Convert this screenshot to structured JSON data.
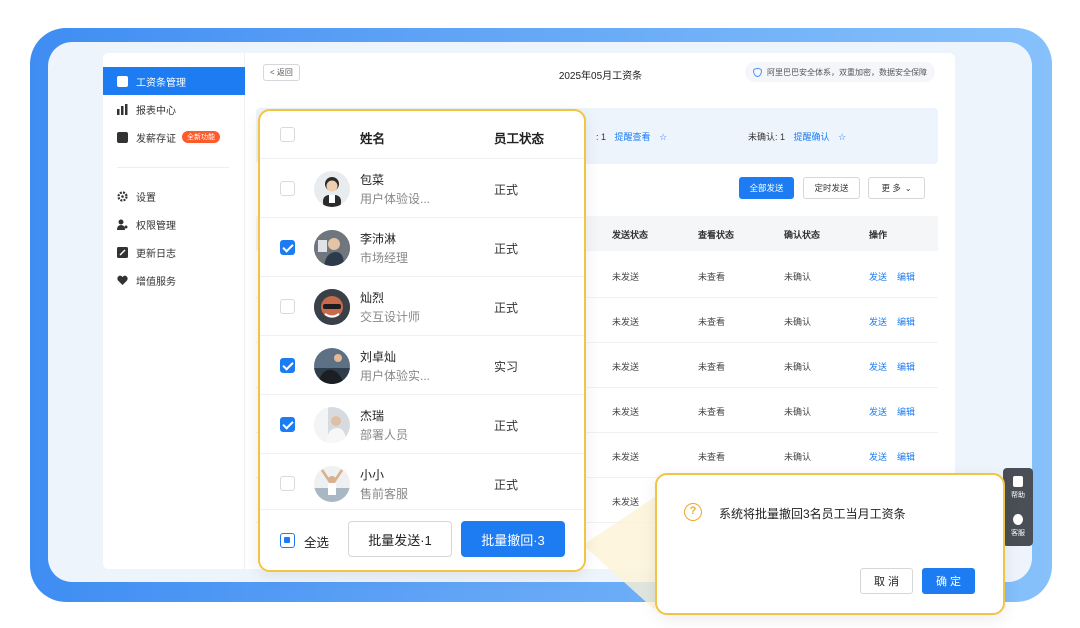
{
  "sidebar": {
    "items": [
      {
        "label": "工资条管理",
        "icon": "payslip-icon",
        "active": true
      },
      {
        "label": "报表中心",
        "icon": "bar-chart-icon"
      },
      {
        "label": "发薪存证",
        "icon": "certificate-icon",
        "badge": "全新功能"
      },
      {
        "label": "设置",
        "icon": "gear-icon"
      },
      {
        "label": "权限管理",
        "icon": "user-key-icon"
      },
      {
        "label": "更新日志",
        "icon": "document-edit-icon"
      },
      {
        "label": "增值服务",
        "icon": "heart-icon"
      }
    ]
  },
  "header": {
    "back_label": "< 返回",
    "title": "2025年05月工资条",
    "security": "阿里巴巴安全体系，双重加密，数据安全保障"
  },
  "stats": {
    "viewed_value": ": 1",
    "viewed_link": "提醒查看",
    "unconfirmed_label": "未确认: 1",
    "unconfirmed_link": "提醒确认"
  },
  "toolbar": {
    "send_all": "全部发送",
    "scheduled": "定时发送",
    "more": "更 多"
  },
  "table": {
    "headers": [
      "发送状态",
      "查看状态",
      "确认状态",
      "操作"
    ],
    "rows": [
      {
        "send": "未发送",
        "view": "未查看",
        "confirm": "未确认",
        "action1": "发送",
        "action2": "编辑"
      },
      {
        "send": "未发送",
        "view": "未查看",
        "confirm": "未确认",
        "action1": "发送",
        "action2": "编辑"
      },
      {
        "send": "未发送",
        "view": "未查看",
        "confirm": "未确认",
        "action1": "发送",
        "action2": "编辑"
      },
      {
        "send": "未发送",
        "view": "未查看",
        "confirm": "未确认",
        "action1": "发送",
        "action2": "编辑"
      },
      {
        "send": "未发送",
        "view": "未查看",
        "confirm": "未确认",
        "action1": "发送",
        "action2": "编辑"
      },
      {
        "send": "未发送",
        "view": "",
        "confirm": "",
        "action1": "",
        "action2": ""
      }
    ]
  },
  "employee_panel": {
    "header_name": "姓名",
    "header_status": "员工状态",
    "employees": [
      {
        "name": "包菜",
        "role": "用户体验设...",
        "status": "正式",
        "checked": false
      },
      {
        "name": "李沛淋",
        "role": "市场经理",
        "status": "正式",
        "checked": true
      },
      {
        "name": "灿烈",
        "role": "交互设计师",
        "status": "正式",
        "checked": false
      },
      {
        "name": "刘卓灿",
        "role": "用户体验实...",
        "status": "实习",
        "checked": true
      },
      {
        "name": "杰瑞",
        "role": "部署人员",
        "status": "正式",
        "checked": true
      },
      {
        "name": "小小",
        "role": "售前客服",
        "status": "正式",
        "checked": false
      }
    ],
    "select_all": "全选",
    "batch_send": "批量发送·1",
    "batch_recall": "批量撤回·3"
  },
  "dialog": {
    "message": "系统将批量撤回3名员工当月工资条",
    "cancel": "取 消",
    "confirm": "确 定"
  },
  "helper": {
    "help": "帮助",
    "service": "客服"
  },
  "colors": {
    "primary": "#1d7cf2",
    "highlight": "#f2c443",
    "badge": "#ff5a2a"
  }
}
